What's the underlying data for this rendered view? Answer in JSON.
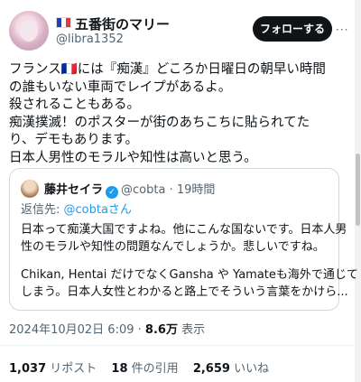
{
  "author": {
    "flag": "🇫🇷",
    "name": "五番街のマリー",
    "handle": "@libra1352",
    "follow_label": "フォローする",
    "more_label": "···"
  },
  "tweet": {
    "lines": [
      "フランス🇫🇷には『痴漢』どころか日曜日の朝早い時間",
      "の誰もいない車両でレイプがあるよ。",
      "殺されることもある。",
      "痴漢撲滅！のポスターが街のあちこちに貼られてた",
      "り、デモもあります。",
      "日本人男性のモラルや知性は高いと思う。"
    ]
  },
  "quote": {
    "name": "藤井セイラ",
    "verified": "✓",
    "handle": "@cobta",
    "separator": "·",
    "time": "19時間",
    "reply_prefix": "返信先: ",
    "reply_mention": "@cobtaさん",
    "para1": [
      "日本って痴漢大国ですよね。他にこんな国ないです。日本人男",
      "性のモラルや知性の問題なんでしょうか。悲しいですね。"
    ],
    "para2": [
      "Chikan, Hentai だけでなくGansha や Yamateも海外で通じて",
      "しまう。日本人女性とわかると路上でそういう言葉をかけら..."
    ]
  },
  "meta": {
    "datetime": "2024年10月02日 6:09",
    "separator": "·",
    "views_count": "8.6万",
    "views_label": "表示"
  },
  "stats": {
    "retweets_count": "1,037",
    "retweets_label": "リポスト",
    "quotes_count": "18",
    "quotes_label": "件の引用",
    "likes_count": "2,659",
    "likes_label": "いいね"
  },
  "colors": {
    "accent": "#1d9bf0",
    "text": "#0f1419",
    "muted": "#536471",
    "border": "#cfd9de"
  }
}
